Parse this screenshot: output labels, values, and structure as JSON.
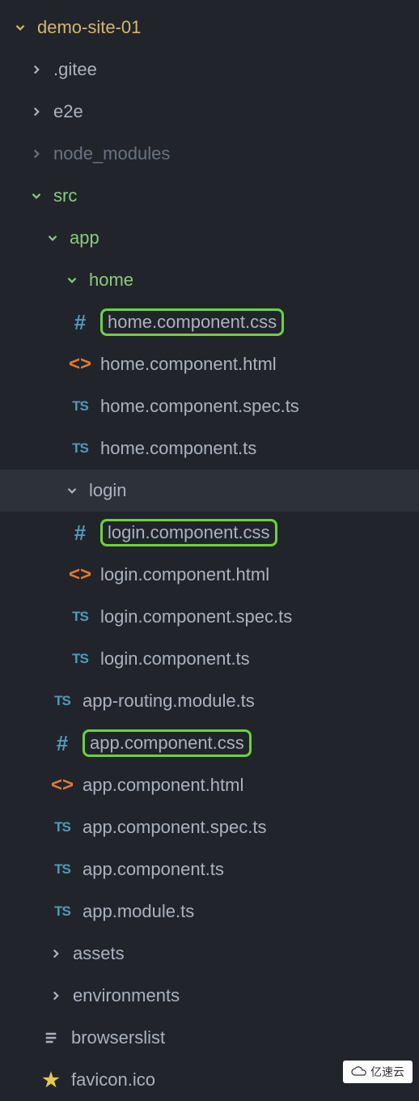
{
  "root": {
    "name": "demo-site-01"
  },
  "folders": {
    "gitee": ".gitee",
    "e2e": "e2e",
    "node_modules": "node_modules",
    "src": "src",
    "app": "app",
    "home": "home",
    "login": "login",
    "assets": "assets",
    "environments": "environments"
  },
  "files": {
    "home_css": "home.component.css",
    "home_html": "home.component.html",
    "home_spec": "home.component.spec.ts",
    "home_ts": "home.component.ts",
    "login_css": "login.component.css",
    "login_html": "login.component.html",
    "login_spec": "login.component.spec.ts",
    "login_ts": "login.component.ts",
    "app_routing": "app-routing.module.ts",
    "app_css": "app.component.css",
    "app_html": "app.component.html",
    "app_spec": "app.component.spec.ts",
    "app_ts": "app.component.ts",
    "app_module": "app.module.ts",
    "browserslist": "browserslist",
    "favicon": "favicon.ico"
  },
  "icons": {
    "ts": "TS",
    "hash": "#",
    "html": "<>",
    "star": "★"
  },
  "watermark": "亿速云"
}
